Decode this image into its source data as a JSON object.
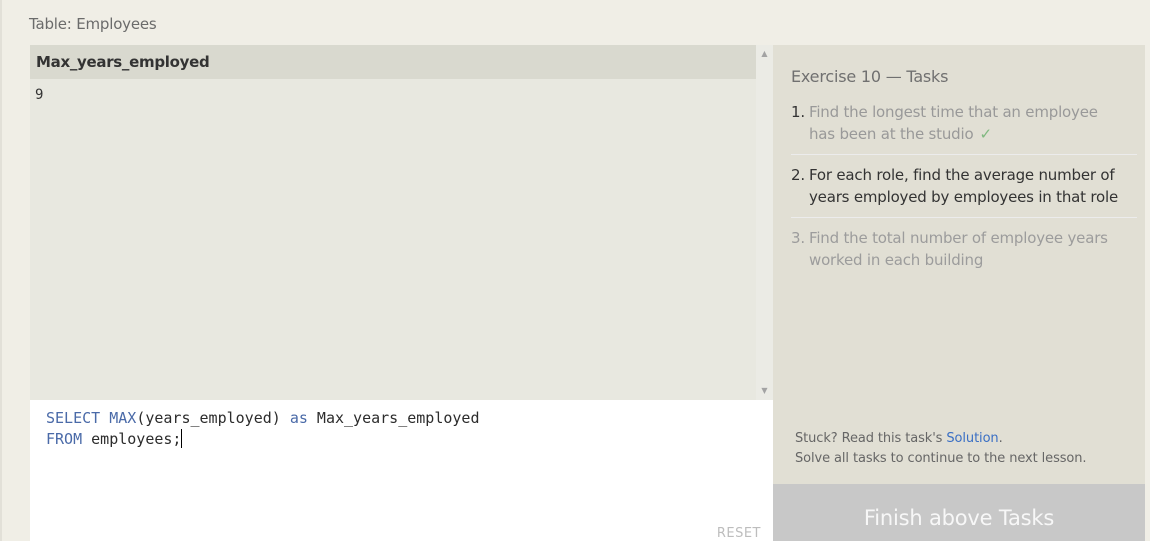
{
  "table_label": "Table: Employees",
  "results": {
    "column_header": "Max_years_employed",
    "cell_value": "9"
  },
  "editor": {
    "line1_kw1": "SELECT",
    "line1_fn": " MAX",
    "line1_mid": "(years_employed) ",
    "line1_kw2": "as",
    "line1_end": " Max_years_employed",
    "line2_kw": "FROM",
    "line2_end": " employees;",
    "reset_label": "RESET"
  },
  "tasks": {
    "title": "Exercise 10 — Tasks",
    "items": [
      {
        "num": "1.",
        "text": "Find the longest time that an employee has been at the studio",
        "check": "✓"
      },
      {
        "num": "2.",
        "text": "For each role, find the average number of years employed by employees in that role"
      },
      {
        "num": "3.",
        "text": "Find the total number of employee years worked in each building"
      }
    ],
    "stuck_prefix": "Stuck? Read this task's ",
    "solution_link": "Solution",
    "stuck_suffix": ".",
    "continue_note": "Solve all tasks to continue to the next lesson."
  },
  "finish_button": "Finish above Tasks",
  "colors": {
    "background": "#f0eee6",
    "keyword": "#4a6aa8",
    "link": "#3a6fc4",
    "check": "#7fb87f"
  }
}
